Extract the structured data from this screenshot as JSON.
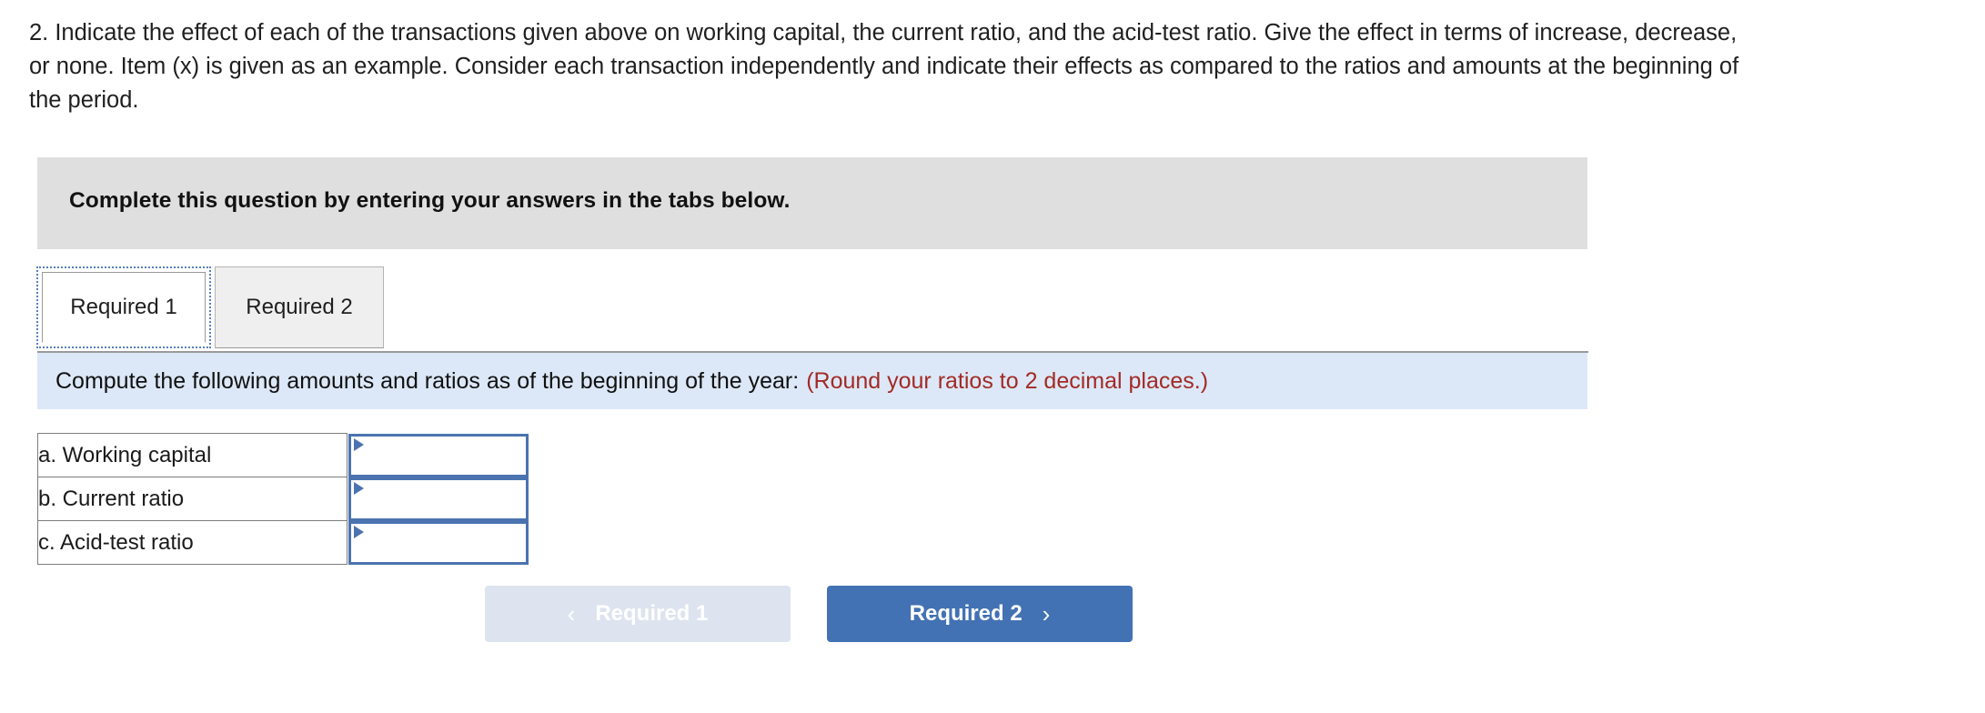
{
  "question": {
    "text": "2. Indicate the effect of each of the transactions given above on working capital, the current ratio, and the acid-test ratio. Give the effect in terms of increase, decrease, or none. Item (x) is given as an example. Consider each transaction independently and indicate their effects as compared to the ratios and amounts at the beginning of the period."
  },
  "banner": {
    "text": "Complete this question by entering your answers in the tabs below."
  },
  "tabs": [
    {
      "label": "Required 1",
      "active": true
    },
    {
      "label": "Required 2",
      "active": false
    }
  ],
  "instruction": {
    "main": "Compute the following amounts and ratios as of the beginning of the year:",
    "note": "(Round your ratios to 2 decimal places.)",
    "note_color": "#a32a25",
    "background": "#dce8f7"
  },
  "answers": {
    "rows": [
      {
        "label": "a. Working capital",
        "value": "",
        "placeholder": ""
      },
      {
        "label": "b. Current ratio",
        "value": "",
        "placeholder": ""
      },
      {
        "label": "c. Acid-test ratio",
        "value": "",
        "placeholder": ""
      }
    ]
  },
  "nav": {
    "prev_label": "Required 1",
    "prev_icon": "chevron-left-icon",
    "prev_glyph": "‹",
    "prev_disabled": true,
    "prev_color": "#dde4ef",
    "next_label": "Required 2",
    "next_icon": "chevron-right-icon",
    "next_glyph": "›",
    "next_color": "#4272b3"
  }
}
